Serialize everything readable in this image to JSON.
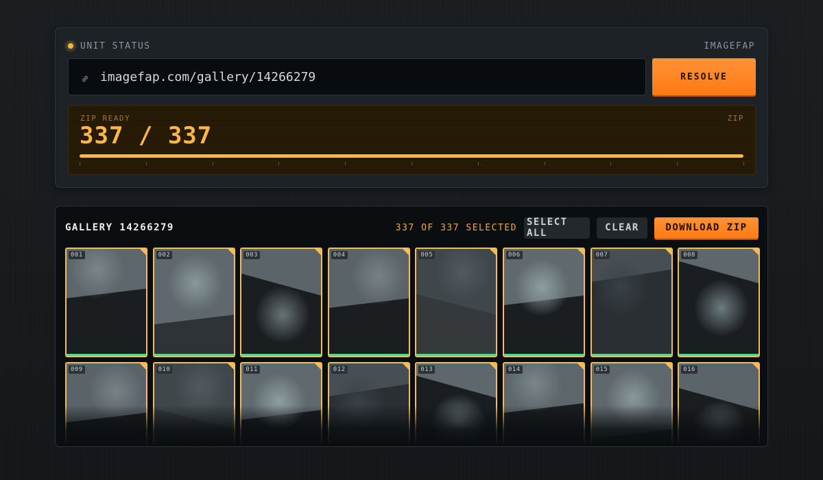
{
  "unit": {
    "status_label": "UNIT STATUS",
    "source_label": "IMAGEFAP",
    "led_color": "#f7b731"
  },
  "resolver": {
    "url_value": "imagefap.com/gallery/14266279",
    "link_icon": "link-icon",
    "resolve_label": "RESOLVE"
  },
  "progress": {
    "state_label": "ZIP READY",
    "format_label": "ZIP",
    "count_text": "337 / 337",
    "done": 337,
    "total": 337,
    "fraction": 1.0
  },
  "gallery": {
    "title": "GALLERY 14266279",
    "selected_text": "337 OF 337 SELECTED",
    "select_all_label": "SELECT ALL",
    "clear_label": "CLEAR",
    "download_label": "DOWNLOAD ZIP",
    "tiles": [
      {
        "num": "001",
        "downloaded": true
      },
      {
        "num": "002",
        "downloaded": true
      },
      {
        "num": "003",
        "downloaded": true
      },
      {
        "num": "004",
        "downloaded": true
      },
      {
        "num": "005",
        "downloaded": true
      },
      {
        "num": "006",
        "downloaded": true
      },
      {
        "num": "007",
        "downloaded": true
      },
      {
        "num": "008",
        "downloaded": true
      },
      {
        "num": "009",
        "downloaded": true
      },
      {
        "num": "010",
        "downloaded": true
      },
      {
        "num": "011",
        "downloaded": true
      },
      {
        "num": "012",
        "downloaded": true
      },
      {
        "num": "013",
        "downloaded": true
      },
      {
        "num": "014",
        "downloaded": true
      },
      {
        "num": "015",
        "downloaded": true
      },
      {
        "num": "016",
        "downloaded": true
      }
    ]
  },
  "colors": {
    "accent_orange": "#ff8420",
    "amber": "#ffb845",
    "selection_border": "#f5bd5a",
    "ok_green": "#5fd28a"
  }
}
